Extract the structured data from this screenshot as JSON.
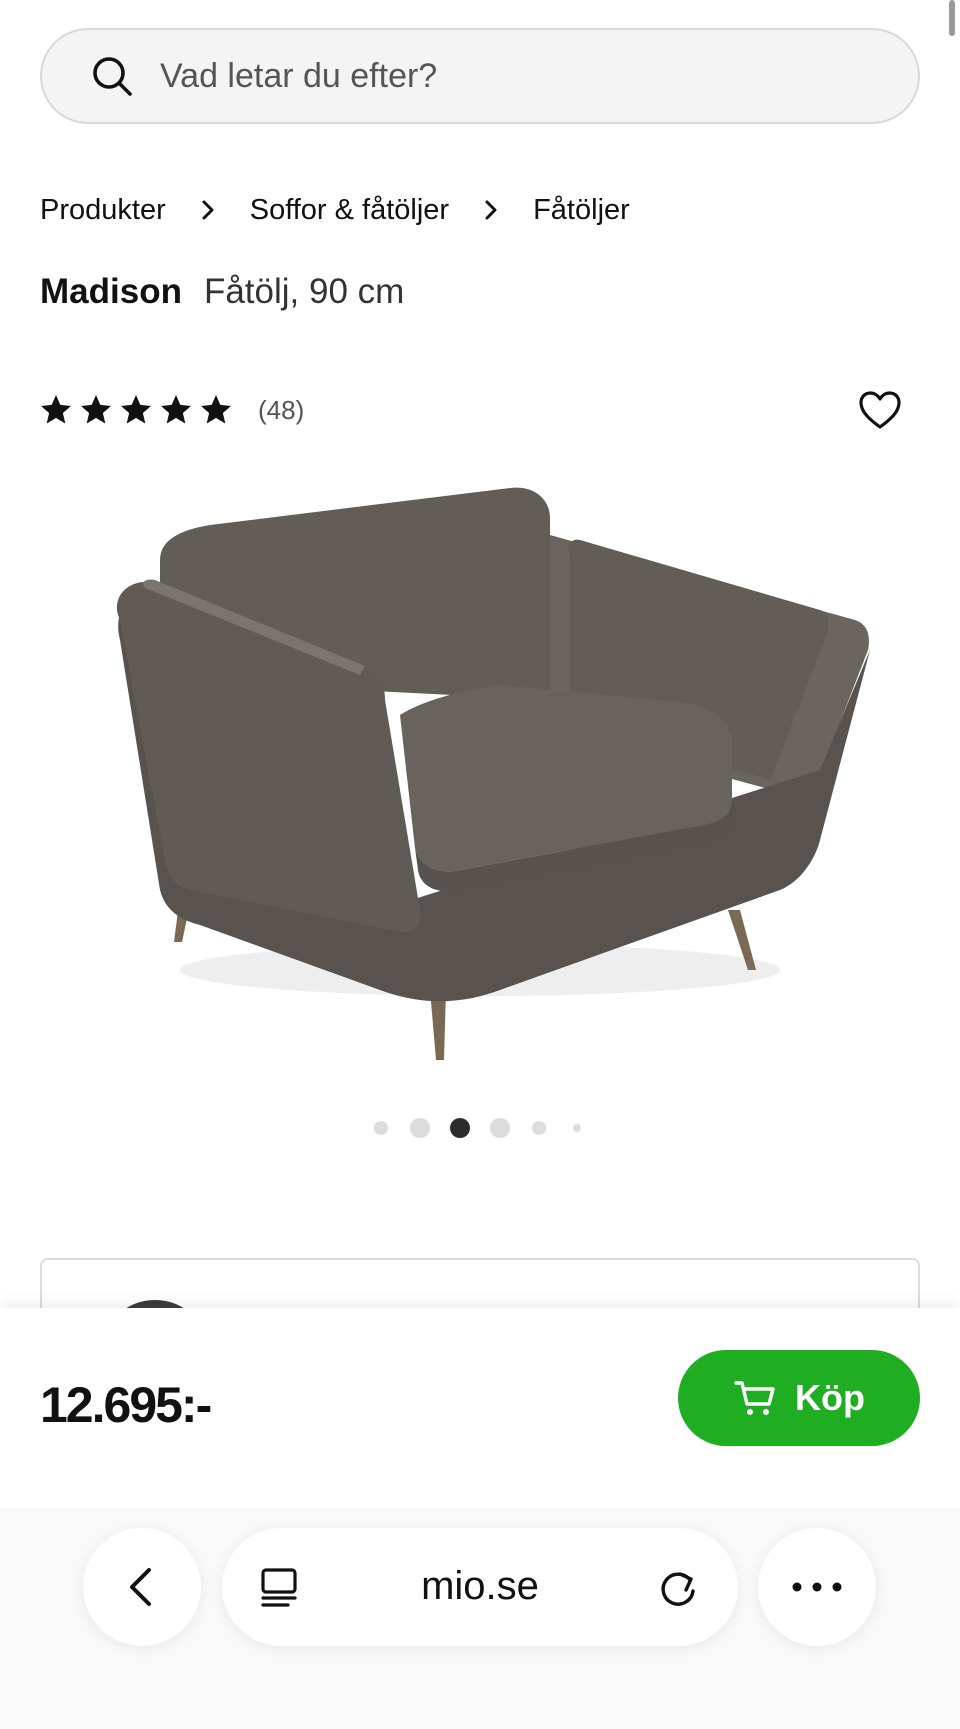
{
  "search": {
    "placeholder": "Vad letar du efter?"
  },
  "breadcrumb": {
    "items": [
      "Produkter",
      "Soffor & fåtöljer",
      "Fåtöljer"
    ]
  },
  "product": {
    "brand": "Madison",
    "subtitle": "Fåtölj, 90 cm",
    "rating": 5,
    "review_count": "(48)",
    "image_icon": "armchair-image",
    "carousel": {
      "total": 6,
      "active_index": 2
    }
  },
  "buy": {
    "price": "12.695:-",
    "button_label": "Köp",
    "button_color": "#1fae22"
  },
  "browser": {
    "url": "mio.se"
  },
  "icons": {
    "search": "search-icon",
    "chevron": "chevron-right-icon",
    "star": "star-icon",
    "favorite": "heart-icon",
    "cart": "cart-icon",
    "back": "back-icon",
    "reader": "reader-icon",
    "reload": "reload-icon",
    "more": "more-icon"
  }
}
